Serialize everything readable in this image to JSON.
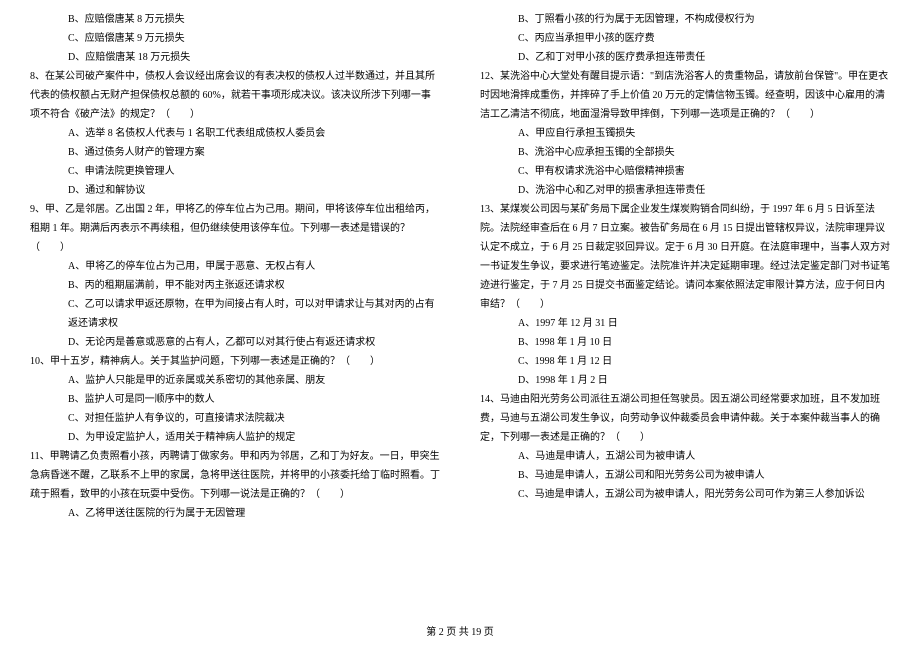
{
  "left": {
    "opt_b7": "B、应赔偿唐某 8 万元损失",
    "opt_c7": "C、应赔偿唐某 9 万元损失",
    "opt_d7": "D、应赔偿唐某 18 万元损失",
    "q8": "8、在某公司破产案件中，债权人会议经出席会议的有表决权的债权人过半数通过，并且其所代表的债权额占无财产担保债权总额的 60%，就若干事项形成决议。该决议所涉下列哪一事项不符合《破产法》的规定？（　　）",
    "opt_a8": "A、选举 8 名债权人代表与 1 名职工代表组成债权人委员会",
    "opt_b8": "B、通过债务人财产的管理方案",
    "opt_c8": "C、申请法院更换管理人",
    "opt_d8": "D、通过和解协议",
    "q9": "9、甲、乙是邻居。乙出国 2 年，甲将乙的停车位占为己用。期间，甲将该停车位出租给丙，租期 1 年。期满后丙表示不再续租，但仍继续使用该停车位。下列哪一表述是错误的？（　　）",
    "opt_a9": "A、甲将乙的停车位占为己用，甲属于恶意、无权占有人",
    "opt_b9": "B、丙的租期届满前，甲不能对丙主张返还请求权",
    "opt_c9": "C、乙可以请求甲返还原物，在甲为间接占有人时，可以对甲请求让与其对丙的占有返还请求权",
    "opt_d9": "D、无论丙是善意或恶意的占有人，乙都可以对其行使占有返还请求权",
    "q10": "10、甲十五岁，精神病人。关于其监护问题，下列哪一表述是正确的？（　　）",
    "opt_a10": "A、监护人只能是甲的近亲属或关系密切的其他亲属、朋友",
    "opt_b10": "B、监护人可是同一顺序中的数人",
    "opt_c10": "C、对担任监护人有争议的，可直接请求法院裁决",
    "opt_d10": "D、为甲设定监护人，适用关于精神病人监护的规定",
    "q11": "11、甲聘请乙负责照看小孩，丙聘请丁做家务。甲和丙为邻居，乙和丁为好友。一日，甲突生急病昏迷不醒，乙联系不上甲的家属，急将甲送往医院，并将甲的小孩委托给丁临时照看。丁疏于照看，致甲的小孩在玩耍中受伤。下列哪一说法是正确的？（　　）",
    "opt_a11": "A、乙将甲送往医院的行为属于无因管理"
  },
  "right": {
    "opt_b11": "B、丁照看小孩的行为属于无因管理，不构成侵权行为",
    "opt_c11": "C、丙应当承担甲小孩的医疗费",
    "opt_d11": "D、乙和丁对甲小孩的医疗费承担连带责任",
    "q12": "12、某洗浴中心大堂处有醒目提示语：\"到店洗浴客人的贵重物品，请放前台保管\"。甲在更衣时因地滑摔成重伤，并摔碎了手上价值 20 万元的定情信物玉镯。经查明，因该中心雇用的清洁工乙清洁不彻底，地面湿滑导致甲摔倒，下列哪一选项是正确的？（　　）",
    "opt_a12": "A、甲应自行承担玉镯损失",
    "opt_b12": "B、洗浴中心应承担玉镯的全部损失",
    "opt_c12": "C、甲有权请求洗浴中心赔偿精神损害",
    "opt_d12": "D、洗浴中心和乙对甲的损害承担连带责任",
    "q13": "13、某煤炭公司因与某矿务局下属企业发生煤炭购销合同纠纷，于 1997 年 6 月 5 日诉至法院。法院经审查后在 6 月 7 日立案。被告矿务局在 6 月 15 日提出管辖权异议，法院审理异议认定不成立，于 6 月 25 日裁定驳回异议。定于 6 月 30 日开庭。在法庭审理中，当事人双方对一书证发生争议，要求进行笔迹鉴定。法院准许并决定延期审理。经过法定鉴定部门对书证笔迹进行鉴定，于 7 月 25 日提交书面鉴定结论。请问本案依照法定审限计算方法，应于何日内审结？（　　）",
    "opt_a13": "A、1997 年 12 月 31 日",
    "opt_b13": "B、1998 年 1 月 10 日",
    "opt_c13": "C、1998 年 1 月 12 日",
    "opt_d13": "D、1998 年 1 月 2 日",
    "q14": "14、马迪由阳光劳务公司派往五湖公司担任驾驶员。因五湖公司经常要求加班，且不发加班费，马迪与五湖公司发生争议，向劳动争议仲裁委员会申请仲裁。关于本案仲裁当事人的确定，下列哪一表述是正确的？（　　）",
    "opt_a14": "A、马迪是申请人，五湖公司为被申请人",
    "opt_b14": "B、马迪是申请人，五湖公司和阳光劳务公司为被申请人",
    "opt_c14": "C、马迪是申请人，五湖公司为被申请人，阳光劳务公司可作为第三人参加诉讼"
  },
  "footer": "第 2 页 共 19 页"
}
